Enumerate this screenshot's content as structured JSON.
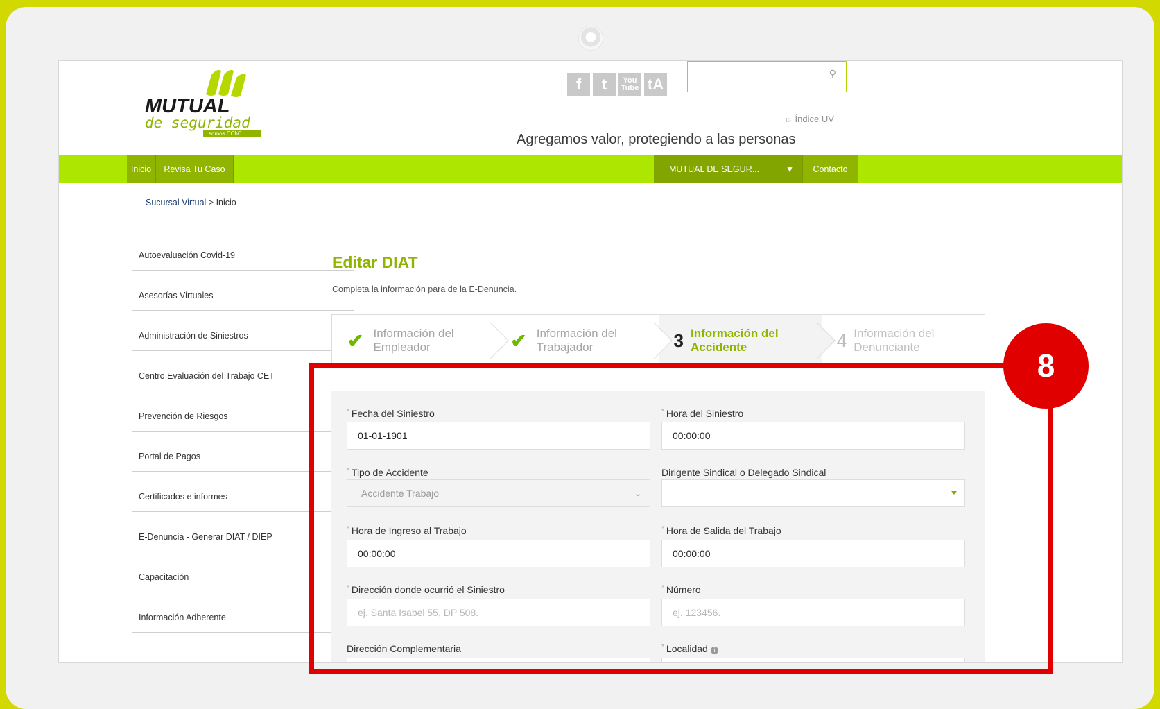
{
  "header": {
    "logo_main": "MUTUAL",
    "logo_sub": "de seguridad",
    "logo_tag": "somos CChC",
    "social": [
      "f",
      "t",
      "You Tube",
      "tA"
    ],
    "search_placeholder": "",
    "uv_label": "Índice UV",
    "tagline": "Agregamos valor, protegiendo a las personas"
  },
  "nav": {
    "inicio": "Inicio",
    "revisa": "Revisa Tu Caso",
    "mutual": "MUTUAL DE SEGUR...",
    "contacto": "Contacto"
  },
  "breadcrumb": {
    "link": "Sucursal Virtual",
    "current": "> Inicio"
  },
  "sidebar": {
    "items": [
      {
        "label": "Autoevaluación Covid-19"
      },
      {
        "label": "Asesorías Virtuales"
      },
      {
        "label": "Administración de Siniestros"
      },
      {
        "label": "Centro Evaluación del Trabajo CET"
      },
      {
        "label": "Prevención de Riesgos"
      },
      {
        "label": "Portal de Pagos"
      },
      {
        "label": "Certificados e informes"
      },
      {
        "label": "E-Denuncia - Generar DIAT / DIEP"
      },
      {
        "label": "Capacitación"
      },
      {
        "label": "Información Adherente"
      }
    ]
  },
  "main": {
    "title": "Editar DIAT",
    "subtitle": "Completa la información para de la E-Denuncia."
  },
  "steps": [
    {
      "label": "Información del Empleador",
      "num": "",
      "state": "done"
    },
    {
      "label": "Información del Trabajador",
      "num": "",
      "state": "done"
    },
    {
      "label": "Información del Accidente",
      "num": "3",
      "state": "active"
    },
    {
      "label": "Información del Denunciante",
      "num": "4",
      "state": "pending"
    }
  ],
  "form": {
    "fecha_label": "Fecha del Siniestro",
    "fecha_value": "01-01-1901",
    "hora_label": "Hora del Siniestro",
    "hora_value": "00:00:00",
    "tipo_label": "Tipo de Accidente",
    "tipo_value": "Accidente Trabajo",
    "dirigente_label": "Dirigente Sindical o Delegado Sindical",
    "dirigente_value": "",
    "ingreso_label": "Hora de Ingreso al Trabajo",
    "ingreso_value": "00:00:00",
    "salida_label": "Hora de Salida del Trabajo",
    "salida_value": "00:00:00",
    "direccion_label": "Dirección donde ocurrió el Siniestro",
    "direccion_placeholder": "ej. Santa Isabel 55, DP 508.",
    "numero_label": "Número",
    "numero_placeholder": "ej. 123456.",
    "complementaria_label": "Dirección Complementaria",
    "localidad_label": "Localidad"
  },
  "annotation": {
    "badge": "8",
    "color": "#e00000"
  }
}
